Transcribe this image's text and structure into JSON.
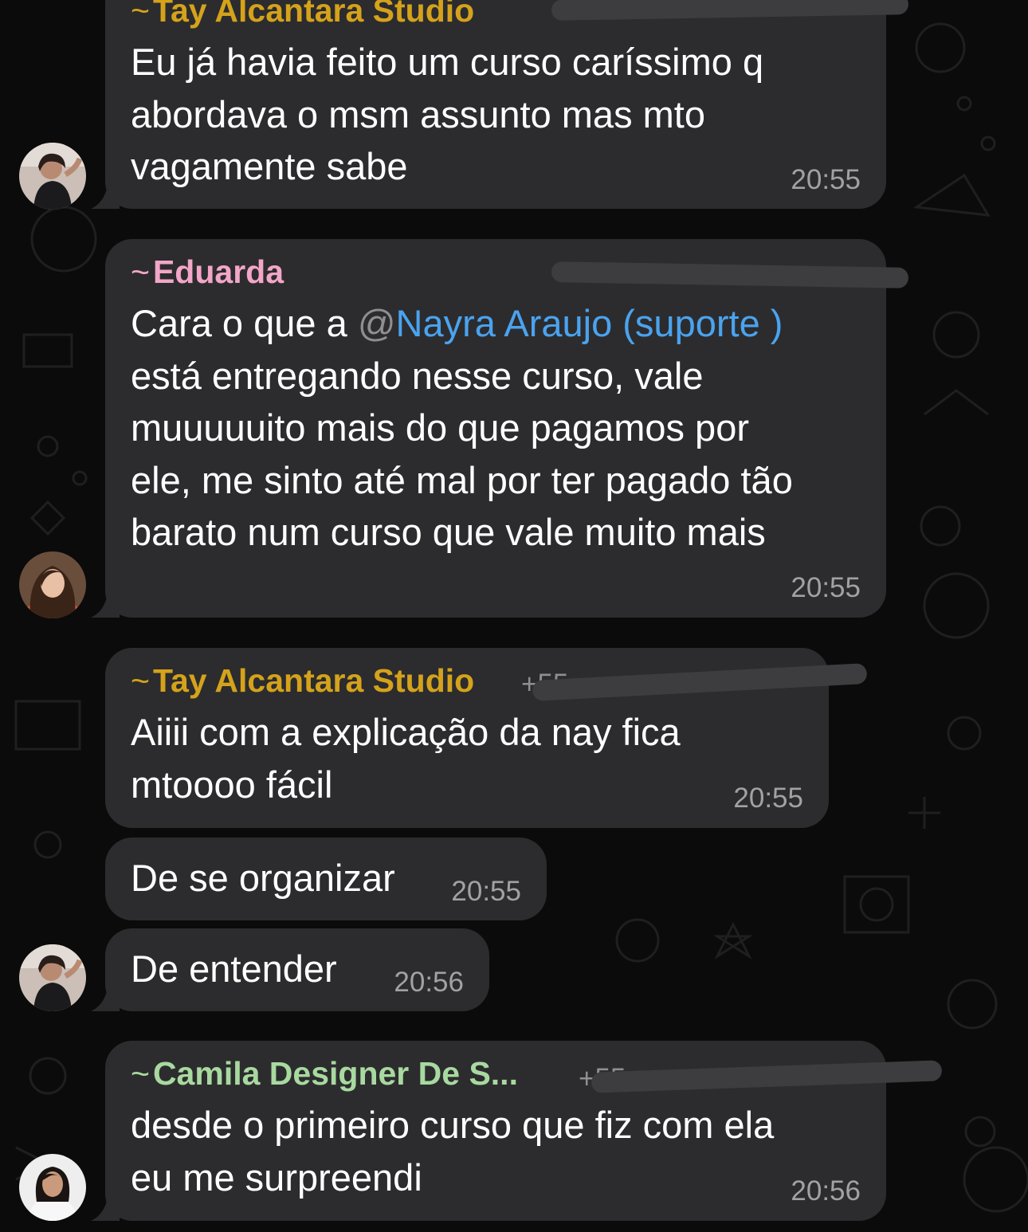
{
  "colors": {
    "background": "#0b0b0b",
    "bubble": "#2c2c2e",
    "tay": "#d4a21b",
    "eduarda": "#f2a6c8",
    "camila": "#a8d9a0",
    "mention": "#4aa3ef"
  },
  "messages": [
    {
      "sender": "Tay Alcantara Studio",
      "tilde": "~",
      "lines": [
        "Eu já havia feito um curso caríssimo q",
        "abordava o msm assunto mas mto",
        "vagamente sabe"
      ],
      "time": "20:55"
    },
    {
      "sender": "Eduarda",
      "tilde": "~",
      "mention_prefix": "Cara o que a ",
      "mention_at": "@",
      "mention_name": "Nayra Araujo (suporte )",
      "lines": [
        "está entregando nesse curso, vale",
        "muuuuuito mais do que pagamos por",
        "ele, me sinto até mal por ter pagado tão",
        "barato num curso que vale muito mais"
      ],
      "time": "20:55"
    },
    {
      "sender": "Tay Alcantara Studio",
      "tilde": "~",
      "phone": "+55",
      "lines": [
        "Aiiii com a explicação da nay fica",
        "mtoooo fácil"
      ],
      "time": "20:55"
    },
    {
      "text": "De se organizar",
      "time": "20:55"
    },
    {
      "text": "De entender",
      "time": "20:56"
    },
    {
      "sender": "Camila Designer De S...",
      "tilde": "~",
      "phone": "+55",
      "lines": [
        "desde o primeiro curso que fiz com ela",
        "eu me surpreendi"
      ],
      "time": "20:56"
    }
  ]
}
